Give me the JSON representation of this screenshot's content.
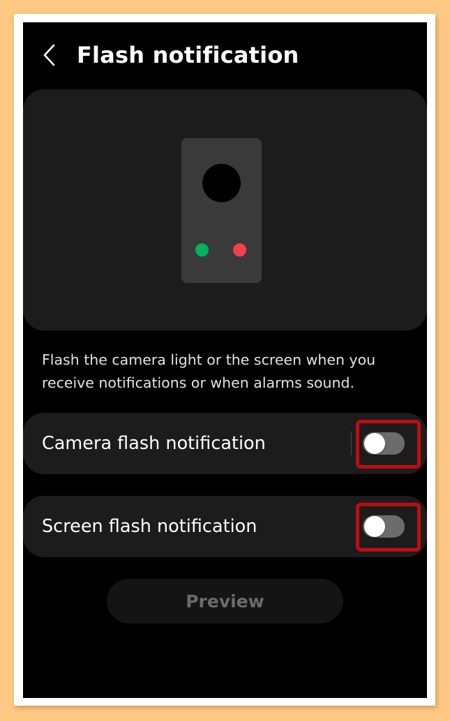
{
  "header": {
    "title": "Flash notification",
    "back_icon": "chevron-left-icon"
  },
  "illustration": {
    "lens_color": "#000000",
    "led_colors": [
      "#00b45a",
      "#f5404a"
    ]
  },
  "description": "Flash the camera light or the screen when you receive notifications or when alarms sound.",
  "settings": [
    {
      "label": "Camera flash notification",
      "enabled": false,
      "highlighted": true
    },
    {
      "label": "Screen flash notification",
      "enabled": false,
      "highlighted": true
    }
  ],
  "preview_button": {
    "label": "Preview",
    "enabled": false
  },
  "colors": {
    "background": "#000000",
    "card": "#1c1c1c",
    "toggle_off_track": "#6c6c6c",
    "highlight": "#c00b12",
    "page_border": "#fcc882"
  }
}
